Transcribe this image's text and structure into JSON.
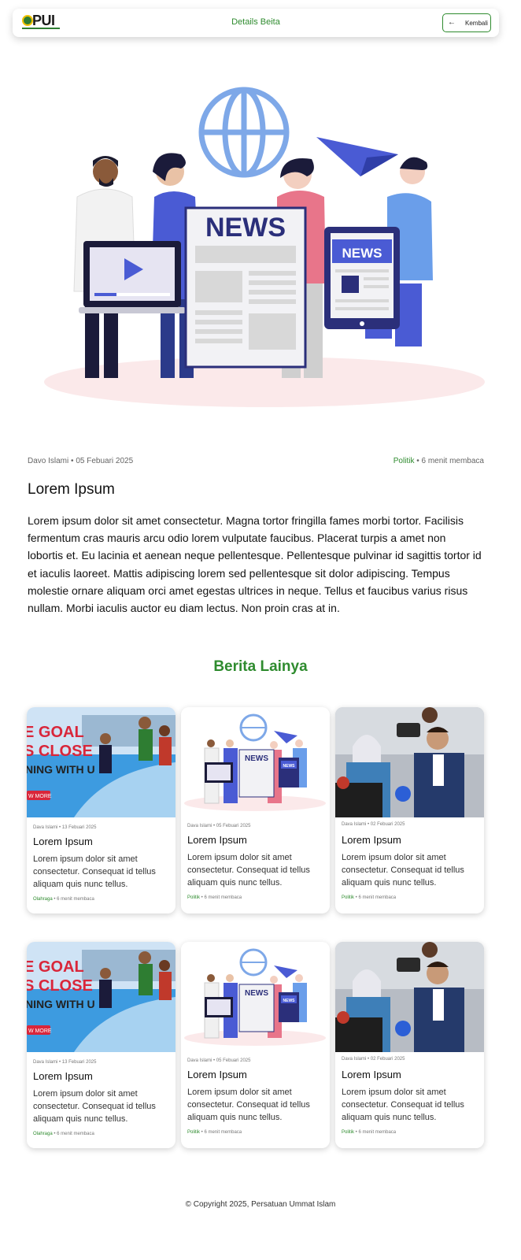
{
  "header": {
    "logo_text": "PUI",
    "title": "Details Beita",
    "back_label": "Kembali"
  },
  "hero": {
    "news_sign": "NEWS",
    "tablet_sign": "NEWS"
  },
  "article": {
    "author": "Davo Islami",
    "date": "05 Febuari 2025",
    "category": "Politik",
    "read_time": "6 menit membaca",
    "title": "Lorem Ipsum",
    "body": "Lorem ipsum dolor sit amet consectetur. Magna tortor fringilla fames morbi tortor. Facilisis fermentum cras mauris arcu odio lorem vulputate faucibus. Placerat turpis a amet non lobortis et. Eu lacinia et aenean neque pellentesque. Pellentesque pulvinar id sagittis tortor id et iaculis laoreet. Mattis adipiscing lorem sed pellentesque sit dolor adipiscing. Tempus molestie ornare aliquam orci amet egestas ultrices in neque. Tellus et faucibus varius risus nullam. Morbi iaculis auctor eu diam lectus. Non proin cras at in."
  },
  "related": {
    "section_title": "Berita Lainya",
    "cards": [
      {
        "meta": "Dava Islami • 13 Febuari 2025",
        "title": "Lorem Ipsum",
        "desc": "Lorem ipsum dolor sit amet consectetur. Consequat id tellus aliquam quis nunc tellus.",
        "category": "Olahraga",
        "read": "6 menit membaca",
        "image": "sports",
        "img_text_1": "E GOAL",
        "img_text_2": "S CLOSE",
        "img_text_3": "NING WITH U",
        "img_btn": "W MORE"
      },
      {
        "meta": "Dava Islami • 05 Febuari 2025",
        "title": "Lorem Ipsum",
        "desc": "Lorem ipsum dolor sit amet consectetur. Consequat id tellus aliquam quis nunc tellus.",
        "category": "Politik",
        "read": "6 menit membaca",
        "image": "news",
        "img_text_1": "NEWS",
        "img_text_2": "NEWS"
      },
      {
        "meta": "Dava Islami • 02 Febuari 2025",
        "title": "Lorem Ipsum",
        "desc": "Lorem ipsum dolor sit amet consectetur. Consequat id tellus aliquam quis nunc tellus.",
        "category": "Politik",
        "read": "6 menit membaca",
        "image": "press"
      },
      {
        "meta": "Dava Islami • 13 Febuari 2025",
        "title": "Lorem Ipsum",
        "desc": "Lorem ipsum dolor sit amet consectetur. Consequat id tellus aliquam quis nunc tellus.",
        "category": "Olahraga",
        "read": "6 menit membaca",
        "image": "sports",
        "img_text_1": "E GOAL",
        "img_text_2": "S CLOSE",
        "img_text_3": "NING WITH U",
        "img_btn": "W MORE"
      },
      {
        "meta": "Dava Islami • 05 Febuari 2025",
        "title": "Lorem Ipsum",
        "desc": "Lorem ipsum dolor sit amet consectetur. Consequat id tellus aliquam quis nunc tellus.",
        "category": "Politik",
        "read": "6 menit membaca",
        "image": "news",
        "img_text_1": "NEWS",
        "img_text_2": "NEWS"
      },
      {
        "meta": "Dava Islami • 02 Febuari 2025",
        "title": "Lorem Ipsum",
        "desc": "Lorem ipsum dolor sit amet consectetur. Consequat id tellus aliquam quis nunc tellus.",
        "category": "Politik",
        "read": "6 menit membaca",
        "image": "press"
      }
    ]
  },
  "footer": {
    "copyright": "© Copyright 2025, Persatuan Ummat Islam"
  },
  "colors": {
    "accent": "#2e8b2e",
    "news_blue": "#2b2f7a",
    "globe_blue": "#7ea8e8"
  }
}
